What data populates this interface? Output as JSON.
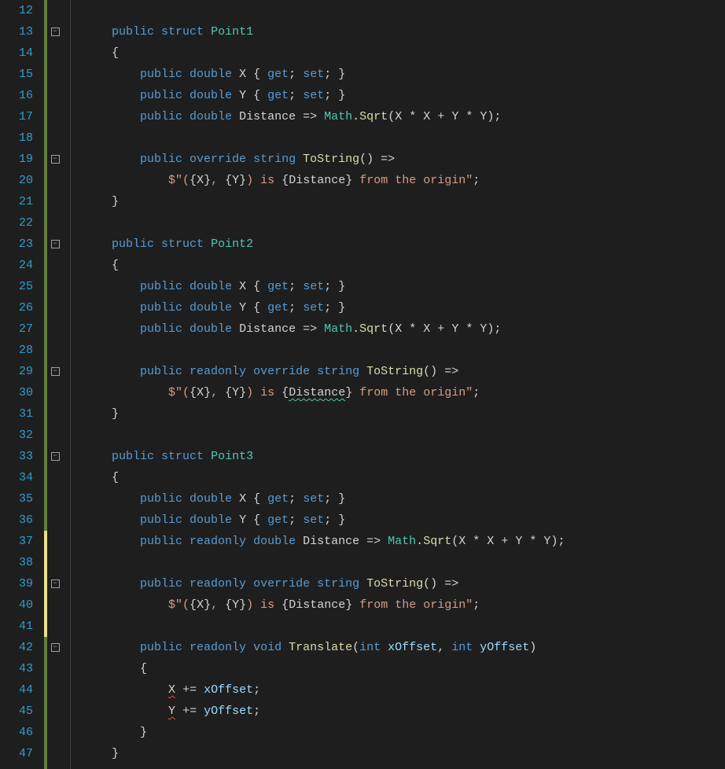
{
  "editor": {
    "first_line": 12,
    "last_line": 47,
    "fold_lines": [
      13,
      19,
      23,
      29,
      33,
      39,
      42
    ],
    "highlight_ranges": [
      [
        37,
        41
      ]
    ],
    "tokens": {
      "kw_public": "public",
      "kw_struct": "struct",
      "kw_double": "double",
      "kw_get": "get",
      "kw_set": "set",
      "kw_override": "override",
      "kw_string": "string",
      "kw_readonly": "readonly",
      "kw_void": "void",
      "kw_int": "int",
      "type_Point1": "Point1",
      "type_Point2": "Point2",
      "type_Point3": "Point3",
      "type_Math": "Math",
      "meth_Sqrt": "Sqrt",
      "meth_ToString": "ToString",
      "meth_Translate": "Translate",
      "id_X": "X",
      "id_Y": "Y",
      "id_Distance": "Distance",
      "id_xOffset": "xOffset",
      "id_yOffset": "yOffset",
      "str_interp_open": "$\"(",
      "str_interp_mid1": ", ",
      "str_interp_mid2": ") is ",
      "str_interp_end": " from the origin\"",
      "p_obrace": "{",
      "p_cbrace": "}",
      "p_oparen": "(",
      "p_cparen": ")",
      "p_semi": ";",
      "p_comma": ",",
      "p_arrow": "=>",
      "p_star": "*",
      "p_plus": "+",
      "p_dot": ".",
      "p_pluseq": "+="
    }
  }
}
